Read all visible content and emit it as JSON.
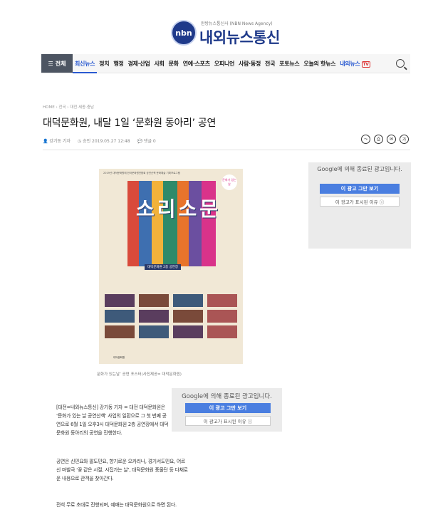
{
  "site": {
    "logo_text": "nbn",
    "tagline": "완방뉴스통신사 (NBN News Agency)",
    "brand": "내외뉴스통신"
  },
  "nav": {
    "all_label": "전체",
    "items": [
      "최신뉴스",
      "정치",
      "행정",
      "경제·산업",
      "사회",
      "문화",
      "연예·스포츠",
      "오피니언",
      "사람·동정",
      "전국",
      "포토뉴스",
      "오늘의 핫뉴스",
      "내외뉴스"
    ],
    "tv_label": "TV"
  },
  "breadcrumb": [
    "HOME",
    "전국",
    "대전·세종·충남"
  ],
  "article": {
    "title": "대덕문화원, 내달 1일 ‘문화원 동아리’ 공연",
    "author": "강기동 기자",
    "approved": "승인 2019.05.27 12:48",
    "comments": "댓글 0",
    "caption": "문화가 있는날’ 공연 포스터(사진제공= 대덕문화원)",
    "paragraphs": [
      "[대전=내외뉴스통신] 강기동 기자 = 대전 대덕문화원은 ‘문화가 있는 날 공연산책’ 사업의 일환으로 그 첫 번째 공연으로 6월 1일 오후3시 대덕문화원 2층 공연장에서 대덕문화원 동아리의 공연을 진행한다.",
      "공연은 신민요와 팔도민요, 향기로운 오카리나, 경기서도민요, 어르신 마발극 ‘꽃 같은 시절, 시집가는 날’, 대덕문화원 풍물단 등 다채로운 내용으로 관객을 찾아간다.",
      "전석 무료 초대로 진행되며, 예매는 대덕문화원으로 하면 된다."
    ]
  },
  "poster": {
    "top_text": "2019년 대덕문화원에 한국문화원연합회 공연산책 문화예술 기획프로그램",
    "title": "소리소문",
    "subtitle": "대덕문화원 2층 공연장",
    "stamp": "문화가 있는날",
    "footer": "대덕문화원"
  },
  "ads": {
    "side": {
      "heading": "Google에 의해 종료된 광고입니다.",
      "stop_label": "이 광고 그만 보기",
      "why_label": "이 광고가 표시된 이유 ⓘ"
    },
    "inline": {
      "heading": "Google에 의해 종료된 광고입니다.",
      "stop_label": "이 광고 그만 보기",
      "why_label": "이 광고가 표시된 이유 ⓘ"
    }
  },
  "share_icons": [
    "share-icon",
    "print-icon",
    "email-icon",
    "font-size-icon"
  ],
  "colors": {
    "brand_blue": "#1f3a8a",
    "nav_dark": "#4d5562",
    "link_blue": "#2a5ad1",
    "ad_button": "#4a7ee0"
  }
}
